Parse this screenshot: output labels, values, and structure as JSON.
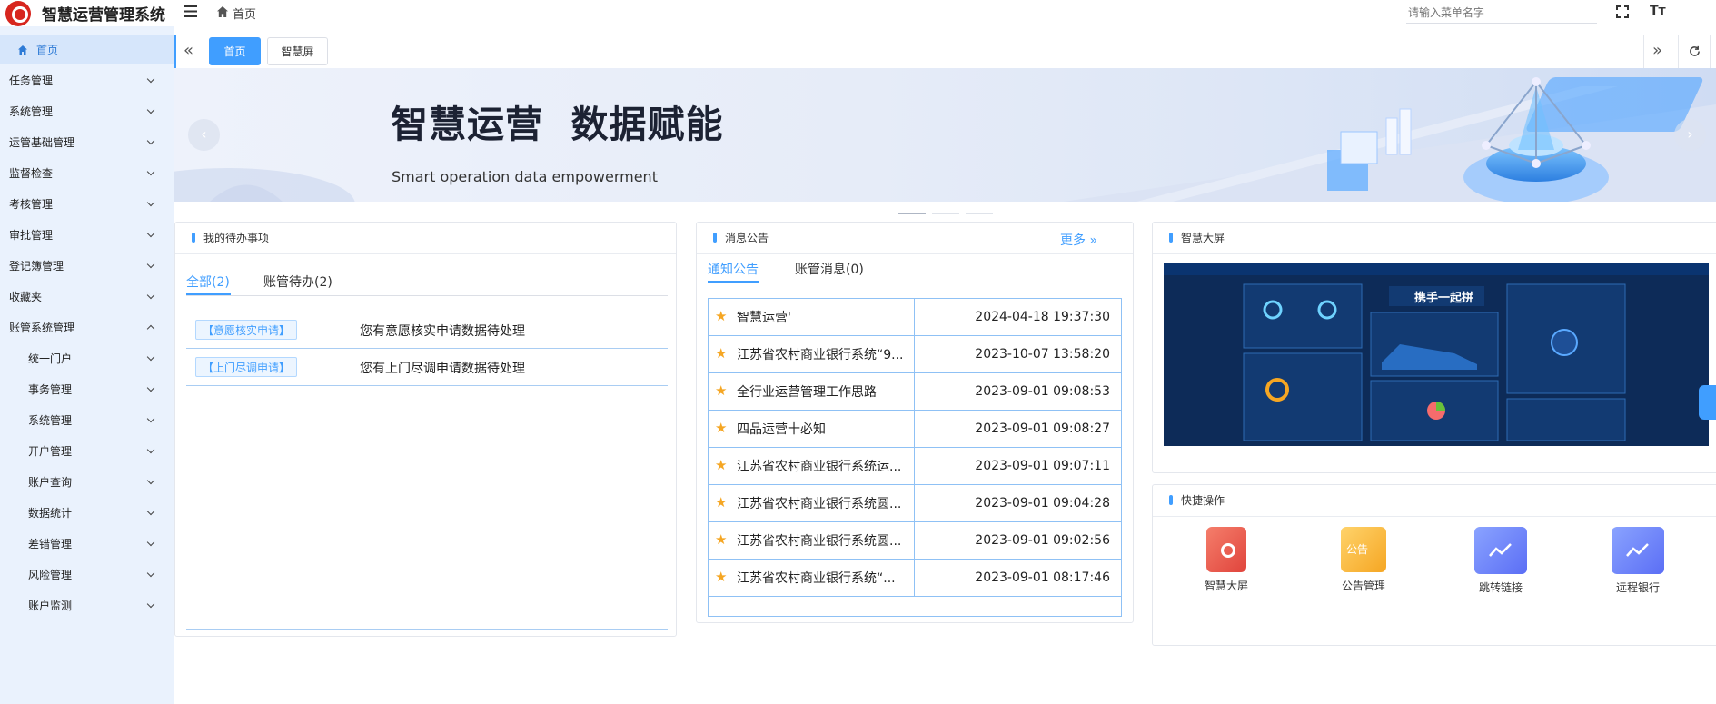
{
  "app": {
    "title": "智慧运营管理系统"
  },
  "sidebar": {
    "home": "首页",
    "items": [
      {
        "label": "任务管理"
      },
      {
        "label": "系统管理"
      },
      {
        "label": "运管基础管理"
      },
      {
        "label": "监督检查"
      },
      {
        "label": "考核管理"
      },
      {
        "label": "审批管理"
      },
      {
        "label": "登记簿管理"
      },
      {
        "label": "收藏夹"
      },
      {
        "label": "账管系统管理"
      }
    ],
    "subitems": [
      {
        "label": "统一门户"
      },
      {
        "label": "事务管理"
      },
      {
        "label": "系统管理"
      },
      {
        "label": "开户管理"
      },
      {
        "label": "账户查询"
      },
      {
        "label": "数据统计"
      },
      {
        "label": "差错管理"
      },
      {
        "label": "风险管理"
      },
      {
        "label": "账户监测"
      }
    ]
  },
  "topbar": {
    "breadcrumb": "首页",
    "search_placeholder": "请输入菜单名字"
  },
  "tabs": {
    "home": "首页",
    "screen": "智慧屏"
  },
  "banner": {
    "title": "智慧运营  数据赋能",
    "subtitle": "Smart operation data empowerment"
  },
  "todo": {
    "title": "我的待办事项",
    "tab_all": "全部(2)",
    "tab_account": "账管待办(2)",
    "rows": [
      {
        "tag": "【意愿核实申请】",
        "text": "您有意愿核实申请数据待处理"
      },
      {
        "tag": "【上门尽调申请】",
        "text": "您有上门尽调申请数据待处理"
      }
    ]
  },
  "notice": {
    "title": "消息公告",
    "more": "更多",
    "tab_notice": "通知公告",
    "tab_account": "账管消息(0)",
    "rows": [
      {
        "title": "智慧运营'",
        "date": "2024-04-18 19:37:30"
      },
      {
        "title": "江苏省农村商业银行系统“9...",
        "date": "2023-10-07 13:58:20"
      },
      {
        "title": "全行业运营管理工作思路",
        "date": "2023-09-01 09:08:53"
      },
      {
        "title": "四品运营十必知",
        "date": "2023-09-01 09:08:27"
      },
      {
        "title": "江苏省农村商业银行系统运...",
        "date": "2023-09-01 09:07:11"
      },
      {
        "title": "江苏省农村商业银行系统圆...",
        "date": "2023-09-01 09:04:28"
      },
      {
        "title": "江苏省农村商业银行系统圆...",
        "date": "2023-09-01 09:02:56"
      },
      {
        "title": "江苏省农村商业银行系统“...",
        "date": "2023-09-01 08:17:46"
      }
    ]
  },
  "screen": {
    "title": "智慧大屏",
    "preview_text": "携手一起拼"
  },
  "quick": {
    "title": "快捷操作",
    "items": [
      {
        "label": "智慧大屏",
        "icon": "big-screen-icon"
      },
      {
        "label": "公告管理",
        "icon": "announcement-icon",
        "badge": "公告"
      },
      {
        "label": "跳转链接",
        "icon": "jump-link-icon"
      },
      {
        "label": "远程银行",
        "icon": "remote-bank-icon"
      }
    ]
  },
  "colors": {
    "accent": "#409eff",
    "sidebar_bg": "#eaf2fd",
    "star": "#f5a623"
  }
}
